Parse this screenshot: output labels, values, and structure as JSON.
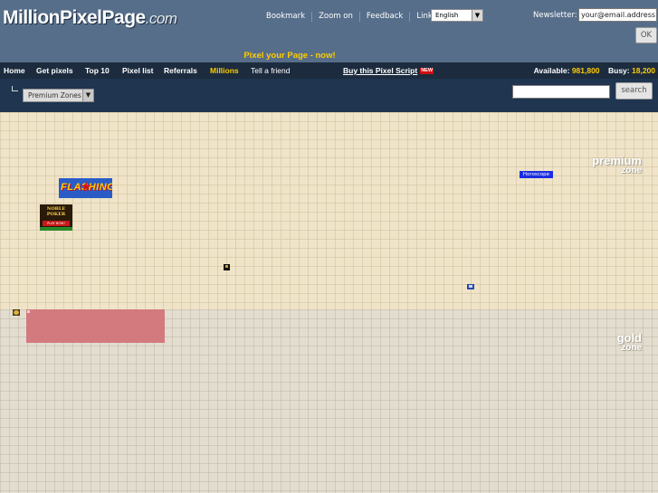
{
  "header": {
    "logo": {
      "main": "MillionPixelPage",
      "suffix": ".com"
    },
    "links": [
      "Bookmark",
      "Zoom on",
      "Feedback",
      "Link us"
    ],
    "language": "English",
    "newsletter": {
      "label": "Newsletter:",
      "value": "your@email.address",
      "ok_label": "OK"
    },
    "promo": "Pixel your Page - now!"
  },
  "nav": {
    "items": [
      "Home",
      "Get pixels",
      "Top 10",
      "Pixel list",
      "Referrals",
      "Millions",
      "Tell a friend"
    ],
    "highlighted": "Millions",
    "buy_script": "Buy this Pixel Script",
    "new_badge": "NEW",
    "available_label": "Available:",
    "available_value": "981,800",
    "busy_label": "Busy:",
    "busy_value": "18,200"
  },
  "zonebar": {
    "zone_select": "Premium Zones",
    "search_value": "",
    "search_label": "search"
  },
  "zones": {
    "premium": {
      "word": "premium",
      "sub": "zone"
    },
    "gold": {
      "word": "gold",
      "sub": "zone"
    }
  },
  "ads": {
    "horoscope": "Horoscope",
    "flash_text": "FLASHING",
    "poker_title": "NOBLE POKER",
    "poker_play": "PLAY NOW!"
  },
  "colors": {
    "header_bg": "#566e8a",
    "nav_bg": "#1c2c3e",
    "accent": "#ffcc00",
    "premium_zone": "#efe4c8",
    "gold_zone": "#e3ddd0"
  }
}
